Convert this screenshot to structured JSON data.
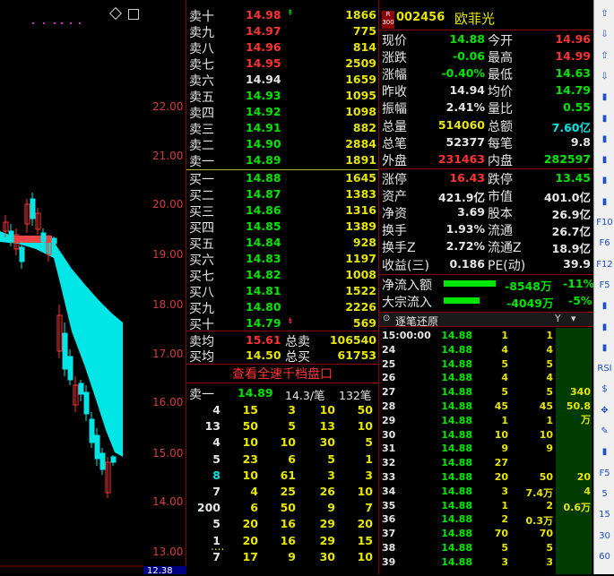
{
  "chart": {
    "y_labels": [
      "22.00",
      "21.00",
      "20.00",
      "19.00",
      "18.00",
      "17.00",
      "16.00",
      "15.00",
      "14.00",
      "13.00"
    ],
    "bottom_price": "12.38"
  },
  "orderbook": {
    "asks": [
      {
        "label": "卖十",
        "price": "14.98",
        "vol": "1866",
        "color": "r",
        "mark": "up"
      },
      {
        "label": "卖九",
        "price": "14.97",
        "vol": "775",
        "color": "r"
      },
      {
        "label": "卖八",
        "price": "14.96",
        "vol": "814",
        "color": "r"
      },
      {
        "label": "卖七",
        "price": "14.95",
        "vol": "2509",
        "color": "r"
      },
      {
        "label": "卖六",
        "price": "14.94",
        "vol": "1659",
        "color": "w"
      },
      {
        "label": "卖五",
        "price": "14.93",
        "vol": "1095",
        "color": "g"
      },
      {
        "label": "卖四",
        "price": "14.92",
        "vol": "1098",
        "color": "g"
      },
      {
        "label": "卖三",
        "price": "14.91",
        "vol": "882",
        "color": "g"
      },
      {
        "label": "卖二",
        "price": "14.90",
        "vol": "2884",
        "color": "g"
      },
      {
        "label": "卖一",
        "price": "14.89",
        "vol": "1891",
        "color": "g"
      }
    ],
    "bids": [
      {
        "label": "买一",
        "price": "14.88",
        "vol": "1645",
        "color": "g"
      },
      {
        "label": "买二",
        "price": "14.87",
        "vol": "1383",
        "color": "g"
      },
      {
        "label": "买三",
        "price": "14.86",
        "vol": "1316",
        "color": "g"
      },
      {
        "label": "买四",
        "price": "14.85",
        "vol": "1389",
        "color": "g"
      },
      {
        "label": "买五",
        "price": "14.84",
        "vol": "928",
        "color": "g"
      },
      {
        "label": "买六",
        "price": "14.83",
        "vol": "1197",
        "color": "g"
      },
      {
        "label": "买七",
        "price": "14.82",
        "vol": "1008",
        "color": "g"
      },
      {
        "label": "买八",
        "price": "14.81",
        "vol": "1522",
        "color": "g"
      },
      {
        "label": "买九",
        "price": "14.80",
        "vol": "2226",
        "color": "g"
      },
      {
        "label": "买十",
        "price": "14.79",
        "vol": "569",
        "color": "g",
        "mark": "down"
      }
    ],
    "avg_sell_label": "卖均",
    "avg_sell": "15.61",
    "total_sell_label": "总卖",
    "total_sell": "106540",
    "avg_buy_label": "买均",
    "avg_buy": "14.50",
    "total_buy_label": "总买",
    "total_buy": "61753",
    "full_button": "查看全速千档盘口",
    "queue_label": "卖一",
    "queue_price": "14.89",
    "queue_avg": "14.3/笔",
    "queue_count": "132笔",
    "queue": [
      [
        "4",
        "15",
        "3",
        "10",
        "50"
      ],
      [
        "13",
        "50",
        "5",
        "13",
        "10"
      ],
      [
        "4",
        "10",
        "10",
        "30",
        "5"
      ],
      [
        "5",
        "23",
        "6",
        "5",
        "1"
      ],
      [
        "8",
        "10",
        "61",
        "3",
        "3"
      ],
      [
        "7",
        "4",
        "25",
        "26",
        "10"
      ],
      [
        "200",
        "6",
        "50",
        "9",
        "7"
      ],
      [
        "5",
        "20",
        "16",
        "29",
        "20"
      ],
      [
        "1",
        "20",
        "16",
        "29",
        "15"
      ],
      [
        "7",
        "17",
        "9",
        "30",
        "10"
      ]
    ],
    "queue_more": "...."
  },
  "info": {
    "badge_top": "R",
    "badge_bottom": "300",
    "code": "002456",
    "name": "欧菲光",
    "rows": [
      {
        "l1": "现价",
        "v1": "14.88",
        "c1": "g",
        "l2": "今开",
        "v2": "14.96",
        "c2": "r"
      },
      {
        "l1": "涨跌",
        "v1": "-0.06",
        "c1": "g",
        "l2": "最高",
        "v2": "14.99",
        "c2": "r"
      },
      {
        "l1": "涨幅",
        "v1": "-0.40%",
        "c1": "g",
        "l2": "最低",
        "v2": "14.63",
        "c2": "g"
      },
      {
        "l1": "昨收",
        "v1": "14.94",
        "c1": "w",
        "l2": "均价",
        "v2": "14.79",
        "c2": "g"
      },
      {
        "l1": "振幅",
        "v1": "2.41%",
        "c1": "w",
        "l2": "量比",
        "v2": "0.55",
        "c2": "g"
      },
      {
        "l1": "总量",
        "v1": "514060",
        "c1": "y",
        "l2": "总额",
        "v2": "7.60亿",
        "c2": "c"
      },
      {
        "l1": "总笔",
        "v1": "52377",
        "c1": "w",
        "l2": "每笔",
        "v2": "9.8",
        "c2": "w"
      },
      {
        "l1": "外盘",
        "v1": "231463",
        "c1": "r",
        "l2": "内盘",
        "v2": "282597",
        "c2": "g"
      },
      {
        "l1": "涨停",
        "v1": "16.43",
        "c1": "r",
        "l2": "跌停",
        "v2": "13.45",
        "c2": "g"
      },
      {
        "l1": "资产",
        "v1": "421.9亿",
        "c1": "w",
        "l2": "市值",
        "v2": "401.0亿",
        "c2": "w"
      },
      {
        "l1": "净资",
        "v1": "3.69",
        "c1": "w",
        "l2": "股本",
        "v2": "26.9亿",
        "c2": "w"
      },
      {
        "l1": "换手",
        "v1": "1.93%",
        "c1": "w",
        "l2": "流通",
        "v2": "26.7亿",
        "c2": "w"
      },
      {
        "l1": "换手Z",
        "v1": "2.72%",
        "c1": "w",
        "l2": "流通Z",
        "v2": "18.9亿",
        "c2": "w"
      },
      {
        "l1": "收益(三)",
        "v1": "0.186",
        "c1": "w",
        "l2": "PE(动)",
        "v2": "39.9",
        "c2": "w"
      }
    ],
    "net_inflow_label": "净流入额",
    "net_inflow": "-8548万",
    "net_inflow_pct": "-11%",
    "block_inflow_label": "大宗流入",
    "block_inflow": "-4049万",
    "block_inflow_pct": "-5%",
    "ticks_title": "逐笔还原",
    "ticks": [
      {
        "t": "15:00:00",
        "p": "14.88",
        "v": "1",
        "n": "1"
      },
      {
        "t": "24",
        "p": "14.88",
        "v": "4",
        "n": "4"
      },
      {
        "t": "25",
        "p": "14.88",
        "v": "5",
        "n": "5"
      },
      {
        "t": "26",
        "p": "14.88",
        "v": "4",
        "n": "4"
      },
      {
        "t": "27",
        "p": "14.88",
        "v": "5",
        "n": "5",
        "extra": "340"
      },
      {
        "t": "28",
        "p": "14.88",
        "v": "45",
        "n": "45",
        "extra": "50.8万"
      },
      {
        "t": "29",
        "p": "14.88",
        "v": "1",
        "n": "1"
      },
      {
        "t": "30",
        "p": "14.88",
        "v": "10",
        "n": "10"
      },
      {
        "t": "31",
        "p": "14.88",
        "v": "9",
        "n": "9"
      },
      {
        "t": "32",
        "p": "14.88",
        "v": "27",
        "n": ""
      },
      {
        "t": "33",
        "p": "14.88",
        "v": "20",
        "n": "50",
        "extra": "20"
      },
      {
        "t": "34",
        "p": "14.88",
        "v": "3",
        "n": "7.4万",
        "extra": "4"
      },
      {
        "t": "35",
        "p": "14.88",
        "v": "1",
        "n": "2",
        "extra": "0.6万"
      },
      {
        "t": "36",
        "p": "14.88",
        "v": "2",
        "n": "0.3万"
      },
      {
        "t": "37",
        "p": "14.88",
        "v": "70",
        "n": "70"
      },
      {
        "t": "38",
        "p": "14.88",
        "v": "5",
        "n": "5"
      },
      {
        "t": "39",
        "p": "14.88",
        "v": "3",
        "n": "3"
      }
    ]
  },
  "toolbar": {
    "items": [
      "⇧",
      "⇩",
      "⇧",
      "⇩",
      "▮",
      "▮",
      "▮",
      "▮",
      "▮",
      "▮",
      "F10",
      "F6",
      "F12",
      "F5",
      "▮",
      "▮",
      "▮",
      "RSI",
      "$",
      "✥",
      "✎",
      "▮",
      "F5",
      "5",
      "15",
      "30",
      "60"
    ]
  }
}
